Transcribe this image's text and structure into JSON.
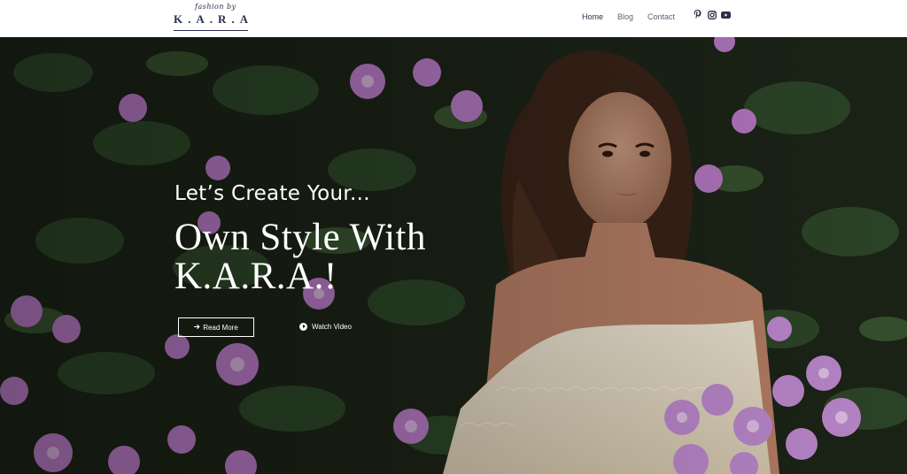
{
  "brand": {
    "tagline": "fashion by",
    "name": "K.A.R.A"
  },
  "nav": {
    "items": [
      {
        "label": "Home",
        "active": true
      },
      {
        "label": "Blog",
        "active": false
      },
      {
        "label": "Contact",
        "active": false
      }
    ]
  },
  "social": {
    "icons": [
      "pinterest-icon",
      "instagram-icon",
      "youtube-icon"
    ],
    "color": "#2b2f4a"
  },
  "hero": {
    "kicker": "Let’s Create Your...",
    "headline": "Own Style With K.A.R.A.!",
    "read_more_label": "Read More",
    "watch_video_label": "Watch Video"
  },
  "colors": {
    "brand_navy": "#2b2f4a",
    "foliage": "#1c2417",
    "flower": "#b77ac4",
    "hero_text": "#ffffff"
  }
}
